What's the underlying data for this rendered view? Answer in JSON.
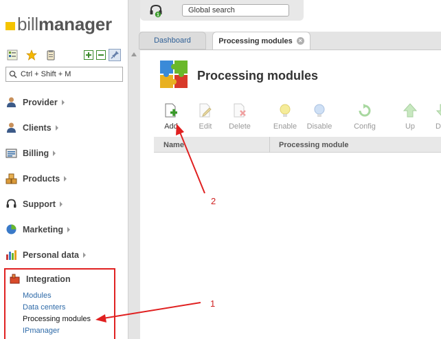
{
  "brand": {
    "light": "bill",
    "bold": "manager"
  },
  "sidebar": {
    "search_placeholder": "Ctrl + Shift + M",
    "items": [
      {
        "label": "Provider",
        "icon": "person-icon"
      },
      {
        "label": "Clients",
        "icon": "person-icon"
      },
      {
        "label": "Billing",
        "icon": "billing-icon"
      },
      {
        "label": "Products",
        "icon": "products-icon"
      },
      {
        "label": "Support",
        "icon": "headset-icon"
      },
      {
        "label": "Marketing",
        "icon": "pie-icon"
      },
      {
        "label": "Personal data",
        "icon": "barchart-icon"
      }
    ],
    "integration": {
      "label": "Integration",
      "subitems": [
        "Modules",
        "Data centers",
        "Processing modules",
        "IPmanager"
      ]
    }
  },
  "topbar": {
    "search": "Global search",
    "notify_count": "1"
  },
  "tabs": [
    {
      "label": "Dashboard"
    },
    {
      "label": "Processing modules"
    }
  ],
  "page": {
    "title": "Processing modules"
  },
  "toolbar": [
    "Add",
    "Edit",
    "Delete",
    "Enable",
    "Disable",
    "Config",
    "Up",
    "D"
  ],
  "table": {
    "columns": [
      "Name",
      "Processing module"
    ]
  },
  "annotations": {
    "first": "1",
    "second": "2"
  },
  "colors": {
    "accent": "#2e6aa8",
    "annotation": "#e02020",
    "logo": "#f5c400"
  }
}
